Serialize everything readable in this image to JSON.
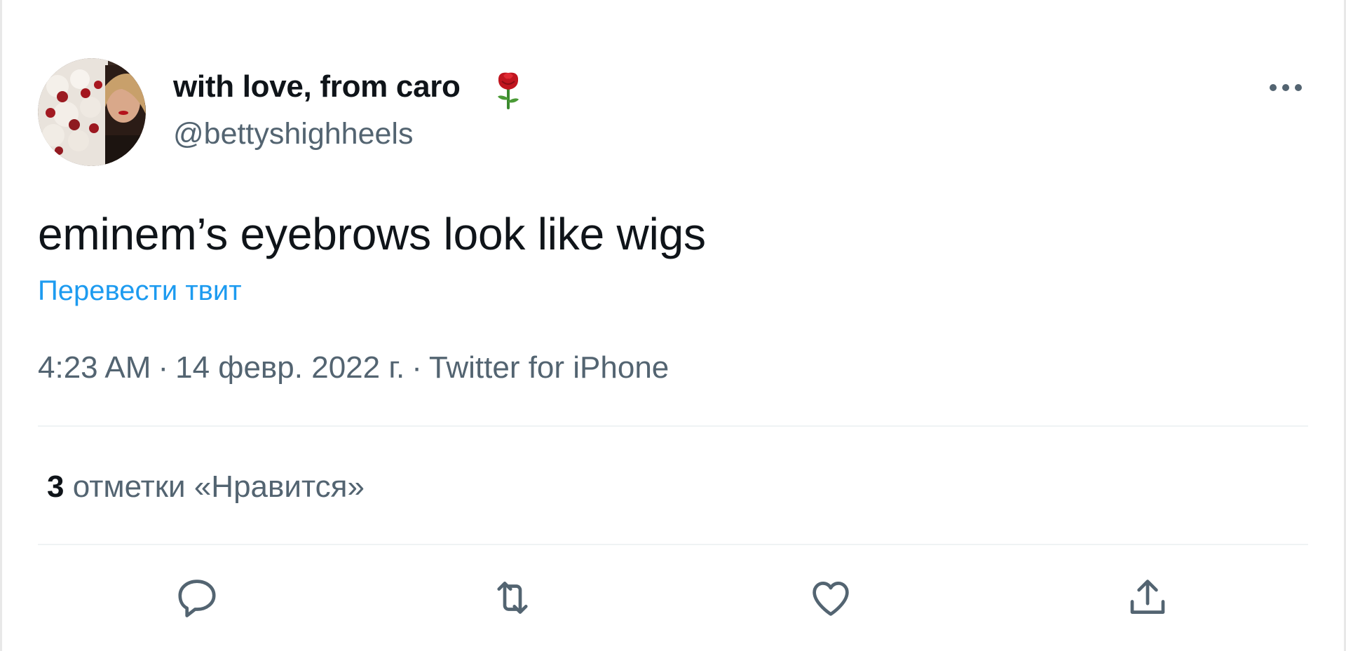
{
  "tweet": {
    "author": {
      "display_name": "with love, from caro",
      "name_emoji": "rose-emoji",
      "handle": "@bettyshighheels"
    },
    "text": "eminem’s eyebrows look like wigs",
    "translate_label": "Перевести твит",
    "time": "4:23 AM",
    "date": "14 февр. 2022 г.",
    "source": "Twitter for iPhone",
    "likes_count": "3",
    "likes_label": "отметки «Нравится»"
  },
  "icons": {
    "more": "more-dots-icon",
    "reply": "reply-icon",
    "retweet": "retweet-icon",
    "like": "heart-icon",
    "share": "share-icon"
  },
  "colors": {
    "text": "#0f1419",
    "secondary_text": "#536471",
    "link": "#1d9bf0",
    "divider": "#eff3f4"
  }
}
